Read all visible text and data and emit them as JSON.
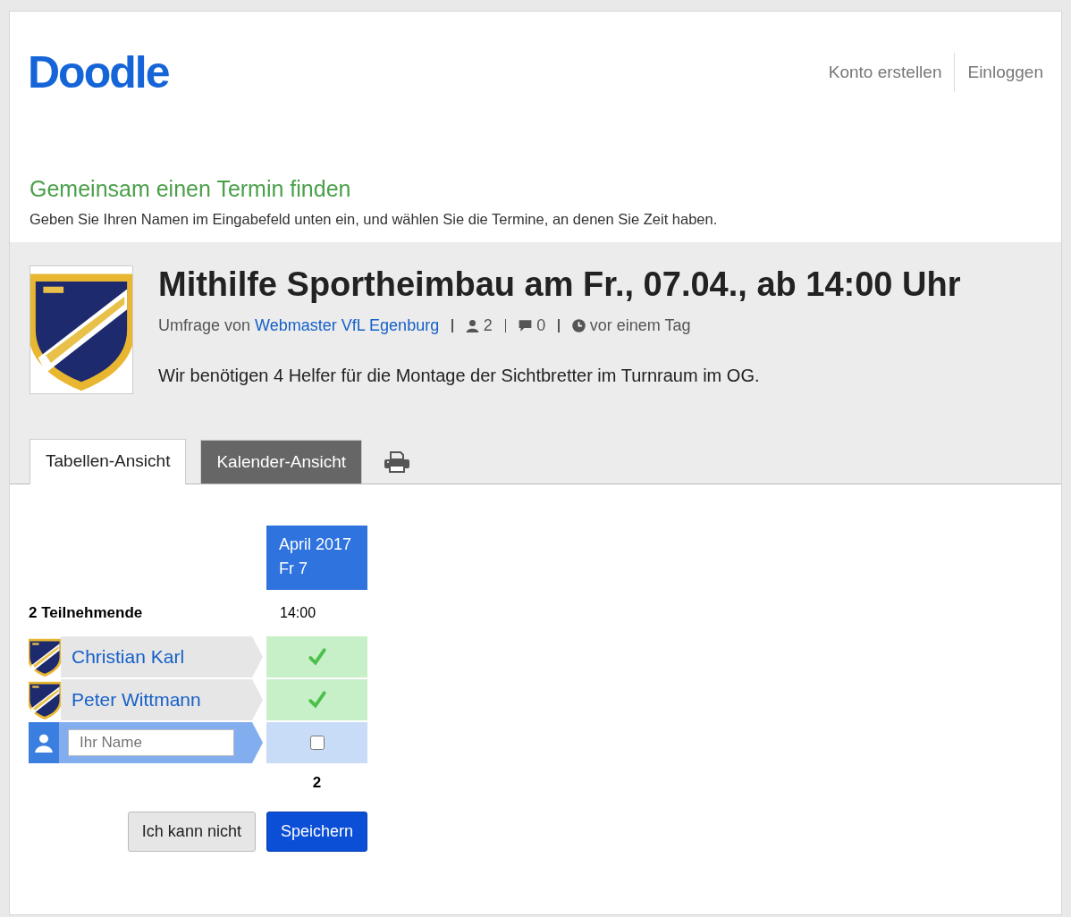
{
  "header": {
    "logo": "Doodle",
    "nav": [
      "Konto erstellen",
      "Einloggen"
    ]
  },
  "intro": {
    "title": "Gemeinsam einen Termin finden",
    "subtitle": "Geben Sie Ihren Namen im Eingabefeld unten ein, und wählen Sie die Termine, an denen Sie Zeit haben."
  },
  "poll": {
    "title": "Mithilfe Sportheimbau am Fr., 07.04., ab 14:00 Uhr",
    "author_prefix": "Umfrage von",
    "author": "Webmaster VfL Egenburg",
    "participants_count": "2",
    "comments_count": "0",
    "time": "vor einem Tag",
    "description": "Wir benötigen 4 Helfer für die Montage der Sichtbretter im Turnraum im OG."
  },
  "tabs": [
    {
      "label": "Tabellen-Ansicht",
      "selected": true
    },
    {
      "label": "Kalender-Ansicht",
      "selected": false
    }
  ],
  "table": {
    "month": "April 2017",
    "day": "Fr 7",
    "participants_label": "2 Teilnehmende",
    "time": "14:00",
    "participants": [
      {
        "name": "Christian Karl",
        "checked": true
      },
      {
        "name": "Peter Wittmann",
        "checked": true
      }
    ],
    "new_row": {
      "placeholder": "Ihr Name",
      "checked": false
    },
    "total": "2",
    "buttons": [
      "Ich kann nicht",
      "Speichern"
    ]
  }
}
